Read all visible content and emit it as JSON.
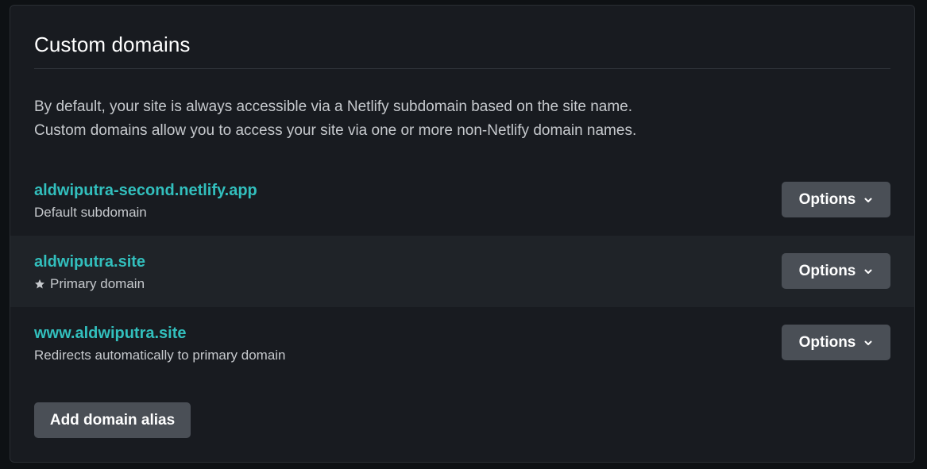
{
  "section": {
    "title": "Custom domains",
    "description_lines": [
      "By default, your site is always accessible via a Netlify subdomain based on the site name.",
      "Custom domains allow you to access your site via one or more non-Netlify domain names."
    ]
  },
  "domains": [
    {
      "name": "aldwiputra-second.netlify.app",
      "subtitle": "Default subdomain",
      "icon": null,
      "options_label": "Options"
    },
    {
      "name": "aldwiputra.site",
      "subtitle": "Primary domain",
      "icon": "star-icon",
      "options_label": "Options"
    },
    {
      "name": "www.aldwiputra.site",
      "subtitle": "Redirects automatically to primary domain",
      "icon": null,
      "options_label": "Options"
    }
  ],
  "actions": {
    "add_alias_label": "Add domain alias"
  },
  "colors": {
    "background": "#0e1114",
    "card": "#181b20",
    "highlight_row": "#1f2328",
    "link": "#32bfbd",
    "button": "#4a4f56",
    "text_muted": "#c6c9cd"
  }
}
